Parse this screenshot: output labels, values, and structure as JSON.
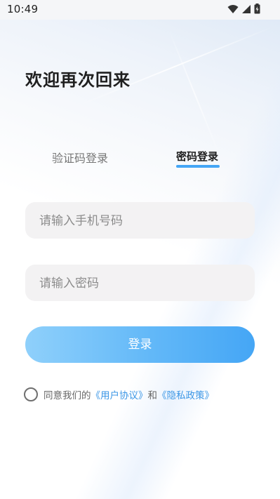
{
  "status_bar": {
    "time": "10:49",
    "icons": [
      "wifi-icon",
      "signal-icon",
      "battery-icon"
    ]
  },
  "header": {
    "title": "欢迎再次回来"
  },
  "tabs": [
    {
      "label": "验证码登录",
      "active": false
    },
    {
      "label": "密码登录",
      "active": true
    }
  ],
  "form": {
    "phone_placeholder": "请输入手机号码",
    "phone_value": "",
    "password_placeholder": "请输入密码",
    "password_value": "",
    "login_label": "登录"
  },
  "agreement": {
    "prefix": "同意我们的",
    "user_agreement": "《用户协议》",
    "connector": "和",
    "privacy_policy": "《隐私政策》",
    "checked": false
  },
  "colors": {
    "accent": "#45a6f5",
    "link": "#3c97e6",
    "title": "#1f1f1f",
    "field_bg": "#f3f2f3"
  }
}
